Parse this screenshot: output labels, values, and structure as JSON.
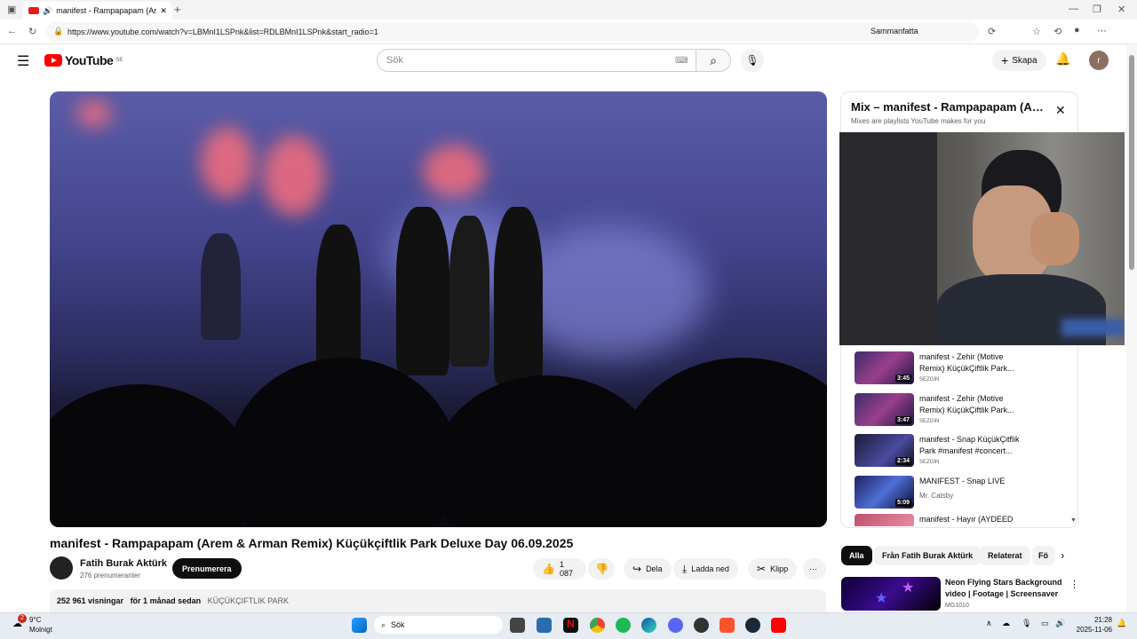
{
  "browser": {
    "tab_title": "manifest - Rampapapam (Are",
    "url": "https://www.youtube.com/watch?v=LBMnI1LSPnk&list=RDLBMnI1LSPnk&start_radio=1",
    "summarize_label": "Sammanfatta"
  },
  "youtube": {
    "logo_text": "YouTube",
    "region": "SE",
    "search_placeholder": "Sök",
    "create_label": "Skapa",
    "avatar_letter": "r"
  },
  "video": {
    "title": "manifest - Rampapapam (Arem & Arman Remix) Küçükçiftlik Park Deluxe Day 06.09.2025",
    "channel": "Fatih Burak Aktürk",
    "subscribers": "276 prenumeranter",
    "subscribe_label": "Prenumerera",
    "likes": "1 087",
    "share_label": "Dela",
    "download_label": "Ladda ned",
    "clip_label": "Klipp",
    "views": "252 961 visningar",
    "age": "för 1 månad sedan",
    "location_tag": "KÜÇÜKÇIFTLIK PARK"
  },
  "playlist": {
    "title": "Mix – manifest - Rampapapam (Arem & Arman Remix)",
    "subtitle": "Mixes are playlists YouTube makes for you",
    "items": [
      {
        "title": "manifest - Zehir (Motive Remix) KüçükÇiftlik Park...",
        "channel": "SEZGIN",
        "duration": "3:45"
      },
      {
        "title": "manifest - Zehir (Motive Remix) KüçükÇiftlik Park...",
        "channel": "SEZGIN",
        "duration": "3:47"
      },
      {
        "title": "manifest - Snap KüçükÇitflik Park #manifest #concert...",
        "channel": "SEZGIN",
        "duration": "2:34"
      },
      {
        "title": "MANIFEST - Snap LIVE",
        "channel": "Mr. Catsby",
        "duration": "5:09"
      },
      {
        "title": "manifest - Hayır (AYDEED",
        "channel": "",
        "duration": ""
      }
    ]
  },
  "chips": [
    "Alla",
    "Från Fatih Burak Aktürk",
    "Relaterat",
    "Fö"
  ],
  "recommendation": {
    "title": "Neon Flying Stars Background video | Footage | Screensaver",
    "channel": "MG1010"
  },
  "taskbar": {
    "temperature": "9°C",
    "weather": "Molnigt",
    "weather_badge": "2",
    "search_label": "Sök",
    "time": "21:28",
    "date": "2025-11-06"
  }
}
